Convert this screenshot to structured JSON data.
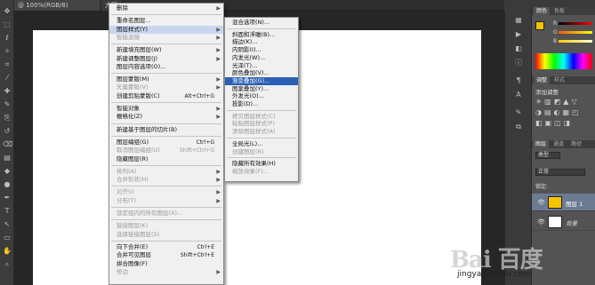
{
  "document": {
    "tab_label": "@ 100%(RGB/8)",
    "tab2_label": "大图",
    "close_glyph": "×"
  },
  "layer_menu": {
    "items": [
      {
        "label": "删除",
        "disabled": false,
        "arrow": true
      },
      {
        "label": "重命名图层...",
        "disabled": false
      },
      {
        "label": "图层样式(Y)",
        "disabled": false,
        "arrow": true,
        "highlight": true
      },
      {
        "label": "智能滤镜",
        "disabled": true,
        "arrow": true
      },
      {
        "label": "新建填充图层(W)",
        "disabled": false,
        "arrow": true
      },
      {
        "label": "新建调整图层(J)",
        "disabled": false,
        "arrow": true
      },
      {
        "label": "图层内容选项(O)...",
        "disabled": false
      },
      {
        "label": "图层蒙版(M)",
        "disabled": false,
        "arrow": true
      },
      {
        "label": "矢量蒙版(V)",
        "disabled": true,
        "arrow": true
      },
      {
        "label": "创建剪贴蒙版(C)",
        "shortcut": "Alt+Ctrl+G",
        "disabled": false
      },
      {
        "label": "智能对象",
        "disabled": false,
        "arrow": true
      },
      {
        "label": "栅格化(Z)",
        "disabled": false,
        "arrow": true
      },
      {
        "label": "新建基于图层的切片(B)",
        "disabled": false
      },
      {
        "label": "图层编组(G)",
        "shortcut": "Ctrl+G",
        "disabled": false
      },
      {
        "label": "取消图层编组(U)",
        "shortcut": "Shift+Ctrl+G",
        "disabled": true
      },
      {
        "label": "隐藏图层(R)",
        "disabled": false
      },
      {
        "label": "排列(A)",
        "disabled": true,
        "arrow": true
      },
      {
        "label": "合并形状(H)",
        "disabled": true,
        "arrow": true
      },
      {
        "label": "对齐(I)",
        "disabled": true,
        "arrow": true
      },
      {
        "label": "分布(T)",
        "disabled": true,
        "arrow": true
      },
      {
        "label": "锁定组内的所有图层(X)...",
        "disabled": true
      },
      {
        "label": "链接图层(K)",
        "disabled": true
      },
      {
        "label": "选择链接图层(S)",
        "disabled": true
      },
      {
        "label": "向下合并(E)",
        "shortcut": "Ctrl+E",
        "disabled": false
      },
      {
        "label": "合并可见图层",
        "shortcut": "Shift+Ctrl+E",
        "disabled": false
      },
      {
        "label": "拼合图像(F)",
        "disabled": false
      },
      {
        "label": "修边",
        "disabled": true,
        "arrow": true
      }
    ]
  },
  "style_submenu": {
    "items": [
      {
        "label": "混合选项(N)...",
        "disabled": false
      },
      {
        "label": "斜面和浮雕(B)...",
        "disabled": false
      },
      {
        "label": "描边(K)...",
        "disabled": false
      },
      {
        "label": "内阴影(I)...",
        "disabled": false
      },
      {
        "label": "内发光(W)...",
        "disabled": false
      },
      {
        "label": "光泽(T)...",
        "disabled": false
      },
      {
        "label": "颜色叠加(V)...",
        "disabled": false
      },
      {
        "label": "渐变叠加(G)...",
        "disabled": false,
        "highlight": true
      },
      {
        "label": "图案叠加(Y)...",
        "disabled": false
      },
      {
        "label": "外发光(O)...",
        "disabled": false
      },
      {
        "label": "投影(D)...",
        "disabled": false
      },
      {
        "label": "拷贝图层样式(C)",
        "disabled": true
      },
      {
        "label": "粘贴图层样式(P)",
        "disabled": true
      },
      {
        "label": "清除图层样式(A)",
        "disabled": true
      },
      {
        "label": "全局光(L)...",
        "disabled": false
      },
      {
        "label": "创建图层(R)",
        "disabled": true
      },
      {
        "label": "隐藏所有效果(H)",
        "disabled": false
      },
      {
        "label": "缩放效果(F)...",
        "disabled": true
      }
    ]
  },
  "right_panel": {
    "color_tabs": [
      "颜色",
      "色板"
    ],
    "channel_labels": [
      "R",
      "G",
      "B"
    ],
    "adjust_tabs": [
      "调整",
      "样式"
    ],
    "adjust_title": "添加调整",
    "layer_tabs": [
      "图层",
      "通道",
      "路径"
    ],
    "kind_label": "类型",
    "blend_mode": "正常",
    "lock_label": "锁定:",
    "layers": [
      {
        "name": "图层 1",
        "selected": true
      },
      {
        "name": "背景",
        "selected": false
      }
    ],
    "foreground_color": "#f5c400",
    "background_color": "#ffffff"
  },
  "watermark": {
    "brand": "Bai 百度",
    "url": "jingyan.baidu.com"
  },
  "colors": {
    "menu_highlight": "#2b5fb4",
    "swatch_yellow": "#f5c400"
  },
  "tool_icons": [
    "move-icon",
    "marquee-icon",
    "lasso-icon",
    "quick-select-icon",
    "crop-icon",
    "eyedropper-icon",
    "healing-icon",
    "brush-icon",
    "stamp-icon",
    "history-brush-icon",
    "eraser-icon",
    "gradient-icon",
    "blur-icon",
    "dodge-icon",
    "pen-icon",
    "type-icon",
    "path-select-icon",
    "shape-icon",
    "hand-icon",
    "zoom-icon"
  ]
}
